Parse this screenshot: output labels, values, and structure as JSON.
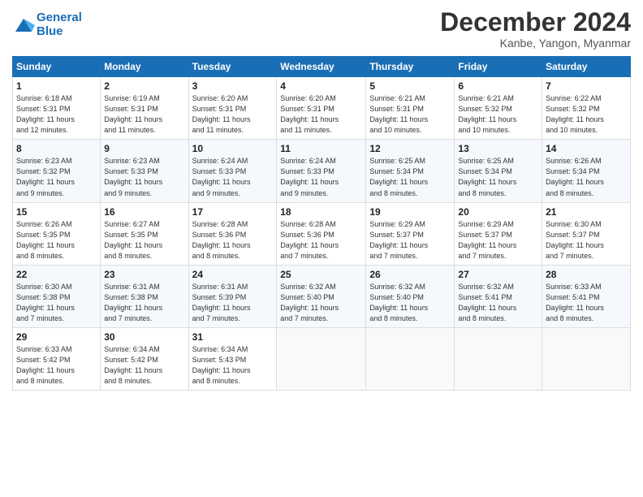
{
  "header": {
    "logo_line1": "General",
    "logo_line2": "Blue",
    "month_title": "December 2024",
    "subtitle": "Kanbe, Yangon, Myanmar"
  },
  "days_of_week": [
    "Sunday",
    "Monday",
    "Tuesday",
    "Wednesday",
    "Thursday",
    "Friday",
    "Saturday"
  ],
  "weeks": [
    [
      {
        "day": "1",
        "info": "Sunrise: 6:18 AM\nSunset: 5:31 PM\nDaylight: 11 hours\nand 12 minutes."
      },
      {
        "day": "2",
        "info": "Sunrise: 6:19 AM\nSunset: 5:31 PM\nDaylight: 11 hours\nand 11 minutes."
      },
      {
        "day": "3",
        "info": "Sunrise: 6:20 AM\nSunset: 5:31 PM\nDaylight: 11 hours\nand 11 minutes."
      },
      {
        "day": "4",
        "info": "Sunrise: 6:20 AM\nSunset: 5:31 PM\nDaylight: 11 hours\nand 11 minutes."
      },
      {
        "day": "5",
        "info": "Sunrise: 6:21 AM\nSunset: 5:31 PM\nDaylight: 11 hours\nand 10 minutes."
      },
      {
        "day": "6",
        "info": "Sunrise: 6:21 AM\nSunset: 5:32 PM\nDaylight: 11 hours\nand 10 minutes."
      },
      {
        "day": "7",
        "info": "Sunrise: 6:22 AM\nSunset: 5:32 PM\nDaylight: 11 hours\nand 10 minutes."
      }
    ],
    [
      {
        "day": "8",
        "info": "Sunrise: 6:23 AM\nSunset: 5:32 PM\nDaylight: 11 hours\nand 9 minutes."
      },
      {
        "day": "9",
        "info": "Sunrise: 6:23 AM\nSunset: 5:33 PM\nDaylight: 11 hours\nand 9 minutes."
      },
      {
        "day": "10",
        "info": "Sunrise: 6:24 AM\nSunset: 5:33 PM\nDaylight: 11 hours\nand 9 minutes."
      },
      {
        "day": "11",
        "info": "Sunrise: 6:24 AM\nSunset: 5:33 PM\nDaylight: 11 hours\nand 9 minutes."
      },
      {
        "day": "12",
        "info": "Sunrise: 6:25 AM\nSunset: 5:34 PM\nDaylight: 11 hours\nand 8 minutes."
      },
      {
        "day": "13",
        "info": "Sunrise: 6:25 AM\nSunset: 5:34 PM\nDaylight: 11 hours\nand 8 minutes."
      },
      {
        "day": "14",
        "info": "Sunrise: 6:26 AM\nSunset: 5:34 PM\nDaylight: 11 hours\nand 8 minutes."
      }
    ],
    [
      {
        "day": "15",
        "info": "Sunrise: 6:26 AM\nSunset: 5:35 PM\nDaylight: 11 hours\nand 8 minutes."
      },
      {
        "day": "16",
        "info": "Sunrise: 6:27 AM\nSunset: 5:35 PM\nDaylight: 11 hours\nand 8 minutes."
      },
      {
        "day": "17",
        "info": "Sunrise: 6:28 AM\nSunset: 5:36 PM\nDaylight: 11 hours\nand 8 minutes."
      },
      {
        "day": "18",
        "info": "Sunrise: 6:28 AM\nSunset: 5:36 PM\nDaylight: 11 hours\nand 7 minutes."
      },
      {
        "day": "19",
        "info": "Sunrise: 6:29 AM\nSunset: 5:37 PM\nDaylight: 11 hours\nand 7 minutes."
      },
      {
        "day": "20",
        "info": "Sunrise: 6:29 AM\nSunset: 5:37 PM\nDaylight: 11 hours\nand 7 minutes."
      },
      {
        "day": "21",
        "info": "Sunrise: 6:30 AM\nSunset: 5:37 PM\nDaylight: 11 hours\nand 7 minutes."
      }
    ],
    [
      {
        "day": "22",
        "info": "Sunrise: 6:30 AM\nSunset: 5:38 PM\nDaylight: 11 hours\nand 7 minutes."
      },
      {
        "day": "23",
        "info": "Sunrise: 6:31 AM\nSunset: 5:38 PM\nDaylight: 11 hours\nand 7 minutes."
      },
      {
        "day": "24",
        "info": "Sunrise: 6:31 AM\nSunset: 5:39 PM\nDaylight: 11 hours\nand 7 minutes."
      },
      {
        "day": "25",
        "info": "Sunrise: 6:32 AM\nSunset: 5:40 PM\nDaylight: 11 hours\nand 7 minutes."
      },
      {
        "day": "26",
        "info": "Sunrise: 6:32 AM\nSunset: 5:40 PM\nDaylight: 11 hours\nand 8 minutes."
      },
      {
        "day": "27",
        "info": "Sunrise: 6:32 AM\nSunset: 5:41 PM\nDaylight: 11 hours\nand 8 minutes."
      },
      {
        "day": "28",
        "info": "Sunrise: 6:33 AM\nSunset: 5:41 PM\nDaylight: 11 hours\nand 8 minutes."
      }
    ],
    [
      {
        "day": "29",
        "info": "Sunrise: 6:33 AM\nSunset: 5:42 PM\nDaylight: 11 hours\nand 8 minutes."
      },
      {
        "day": "30",
        "info": "Sunrise: 6:34 AM\nSunset: 5:42 PM\nDaylight: 11 hours\nand 8 minutes."
      },
      {
        "day": "31",
        "info": "Sunrise: 6:34 AM\nSunset: 5:43 PM\nDaylight: 11 hours\nand 8 minutes."
      },
      {
        "day": "",
        "info": ""
      },
      {
        "day": "",
        "info": ""
      },
      {
        "day": "",
        "info": ""
      },
      {
        "day": "",
        "info": ""
      }
    ]
  ]
}
